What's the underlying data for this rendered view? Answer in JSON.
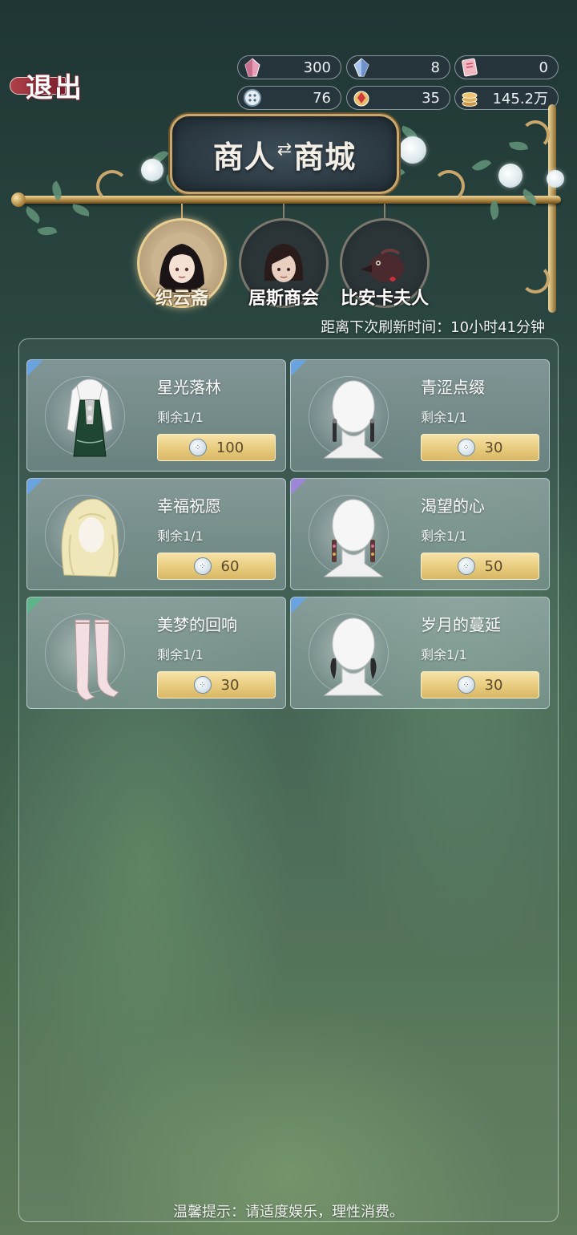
{
  "exit": {
    "label": "退出"
  },
  "currencies": [
    {
      "icon": "pink-crystal-icon",
      "value": "300"
    },
    {
      "icon": "blue-crystal-icon",
      "value": "8"
    },
    {
      "icon": "pink-ticket-icon",
      "value": "0"
    },
    {
      "icon": "button-coin-icon",
      "value": "76"
    },
    {
      "icon": "red-gem-icon",
      "value": "35"
    },
    {
      "icon": "gold-coin-stack-icon",
      "value": "145.2万"
    }
  ],
  "header": {
    "title_main": "商人",
    "title_swap": "商城"
  },
  "merchants": [
    {
      "label": "织云斋",
      "active": true
    },
    {
      "label": "居斯商会",
      "active": false
    },
    {
      "label": "比安卡夫人",
      "active": false
    }
  ],
  "refresh": {
    "text": "距离下次刷新时间：10小时41分钟"
  },
  "items": [
    {
      "name": "星光落林",
      "remain": "剩余1/1",
      "price": "100",
      "icon": "dress-icon",
      "rarity_color": "#6aa4e0"
    },
    {
      "name": "青涩点缀",
      "remain": "剩余1/1",
      "price": "30",
      "icon": "earring-icon",
      "rarity_color": "#6aa4e0"
    },
    {
      "name": "幸福祝愿",
      "remain": "剩余1/1",
      "price": "60",
      "icon": "wig-icon",
      "rarity_color": "#6aa4e0"
    },
    {
      "name": "渴望的心",
      "remain": "剩余1/1",
      "price": "50",
      "icon": "earring-icon",
      "rarity_color": "#9d86d8"
    },
    {
      "name": "美梦的回响",
      "remain": "剩余1/1",
      "price": "30",
      "icon": "stockings-icon",
      "rarity_color": "#5fb58a"
    },
    {
      "name": "岁月的蔓延",
      "remain": "剩余1/1",
      "price": "30",
      "icon": "earring-icon",
      "rarity_color": "#6aa4e0"
    }
  ],
  "footer": {
    "tip": "温馨提示：请适度娱乐，理性消费。"
  }
}
